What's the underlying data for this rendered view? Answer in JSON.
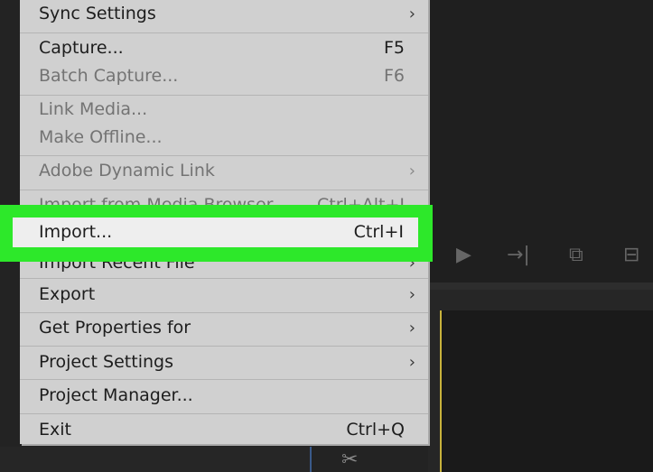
{
  "menu": {
    "items": [
      {
        "label": "Sync Settings",
        "shortcut": "",
        "submenu": true,
        "disabled": false
      },
      {
        "label": "Capture...",
        "shortcut": "F5",
        "submenu": false,
        "disabled": false
      },
      {
        "label": "Batch Capture...",
        "shortcut": "F6",
        "submenu": false,
        "disabled": true
      },
      {
        "label": "Link Media...",
        "shortcut": "",
        "submenu": false,
        "disabled": true
      },
      {
        "label": "Make Offline...",
        "shortcut": "",
        "submenu": false,
        "disabled": true
      },
      {
        "label": "Adobe Dynamic Link",
        "shortcut": "",
        "submenu": true,
        "disabled": true
      },
      {
        "label": "Import from Media Browser",
        "shortcut": "Ctrl+Alt+I",
        "submenu": false,
        "disabled": true
      },
      {
        "label": "Import...",
        "shortcut": "Ctrl+I",
        "submenu": false,
        "disabled": false,
        "highlighted": true
      },
      {
        "label": "Import Recent File",
        "shortcut": "",
        "submenu": true,
        "disabled": false
      },
      {
        "label": "Export",
        "shortcut": "",
        "submenu": true,
        "disabled": false
      },
      {
        "label": "Get Properties for",
        "shortcut": "",
        "submenu": true,
        "disabled": false
      },
      {
        "label": "Project Settings",
        "shortcut": "",
        "submenu": true,
        "disabled": false
      },
      {
        "label": "Project Manager...",
        "shortcut": "",
        "submenu": false,
        "disabled": false
      },
      {
        "label": "Exit",
        "shortcut": "Ctrl+Q",
        "submenu": false,
        "disabled": false
      }
    ],
    "chevron": "›"
  },
  "icons": {
    "step-forward": "step-forward-icon",
    "go-to-out": "go-to-out-icon",
    "insert": "insert-icon",
    "overwrite": "overwrite-icon",
    "razor": "razor-tool-icon"
  },
  "colors": {
    "menu_bg": "#d0d0d0",
    "highlight_green": "#2de82a",
    "app_bg": "#232323"
  }
}
